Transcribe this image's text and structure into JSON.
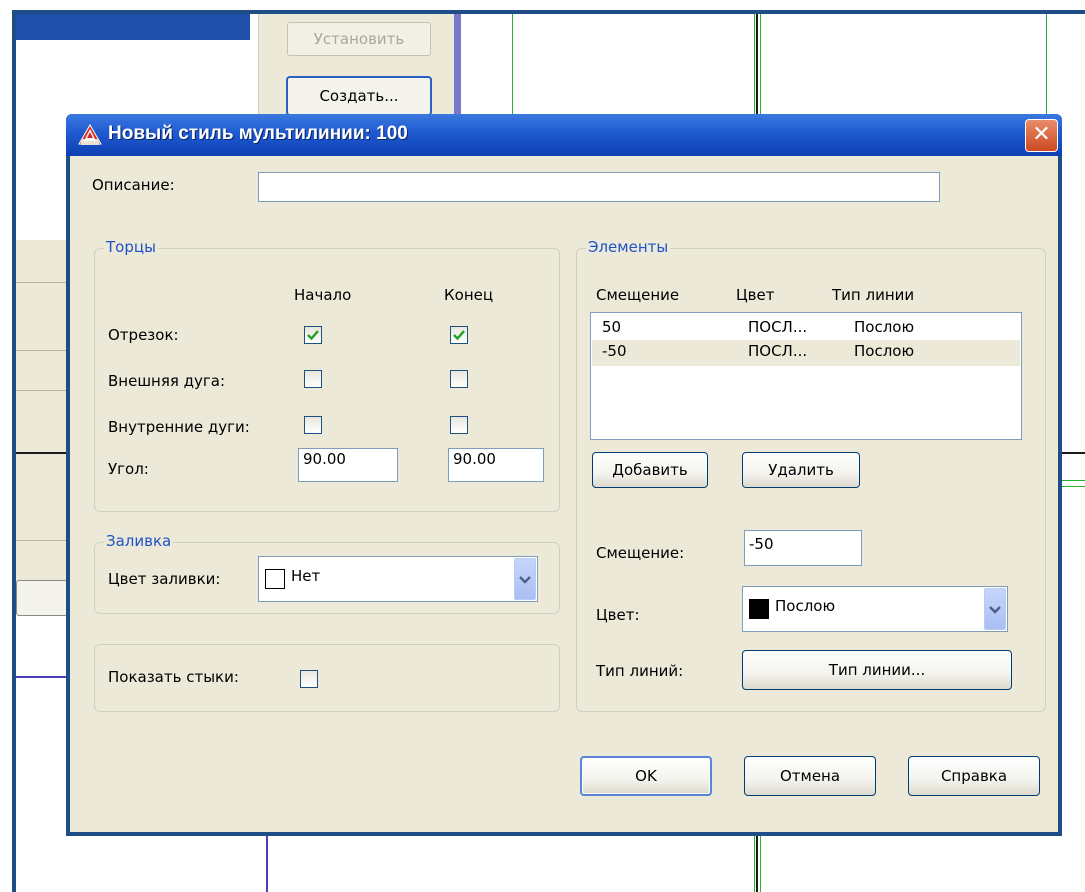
{
  "background": {
    "buttons": {
      "set_label": "Установить",
      "create_label": "Создать..."
    }
  },
  "dialog": {
    "title": "Новый стиль мультилинии: 100",
    "close_glyph": "✕",
    "description": {
      "label": "Описание:",
      "value": ""
    },
    "caps": {
      "title": "Торцы",
      "col_start": "Начало",
      "col_end": "Конец",
      "rows": [
        {
          "label": "Отрезок:",
          "start_checked": true,
          "end_checked": true
        },
        {
          "label": "Внешняя дуга:",
          "start_checked": false,
          "end_checked": false
        },
        {
          "label": "Внутренние дуги:",
          "start_checked": false,
          "end_checked": false
        }
      ],
      "angle": {
        "label": "Угол:",
        "start": "90.00",
        "end": "90.00"
      }
    },
    "fill": {
      "title": "Заливка",
      "label": "Цвет заливки:",
      "value": "Нет",
      "swatch_color": "#ffffff"
    },
    "show_joints": {
      "label": "Показать стыки:",
      "checked": false
    },
    "elements": {
      "title": "Элементы",
      "columns": [
        "Смещение",
        "Цвет",
        "Тип линии"
      ],
      "rows": [
        {
          "offset": "50",
          "color": "ПОСЛ...",
          "linetype": "Послою",
          "selected": false
        },
        {
          "offset": "-50",
          "color": "ПОСЛ...",
          "linetype": "Послою",
          "selected": true
        }
      ],
      "add_label": "Добавить",
      "delete_label": "Удалить",
      "offset_label": "Смещение:",
      "offset_value": "-50",
      "color_label": "Цвет:",
      "color_value": "Послою",
      "color_swatch": "#000000",
      "linetype_label": "Тип линий:",
      "linetype_button": "Тип линии..."
    },
    "buttons": {
      "ok": "OK",
      "cancel": "Отмена",
      "help": "Справка"
    },
    "accent_colors": {
      "titlebar": "#1f5ad0",
      "group_title": "#1f52c8",
      "dialog_face": "#ece9d8"
    }
  }
}
